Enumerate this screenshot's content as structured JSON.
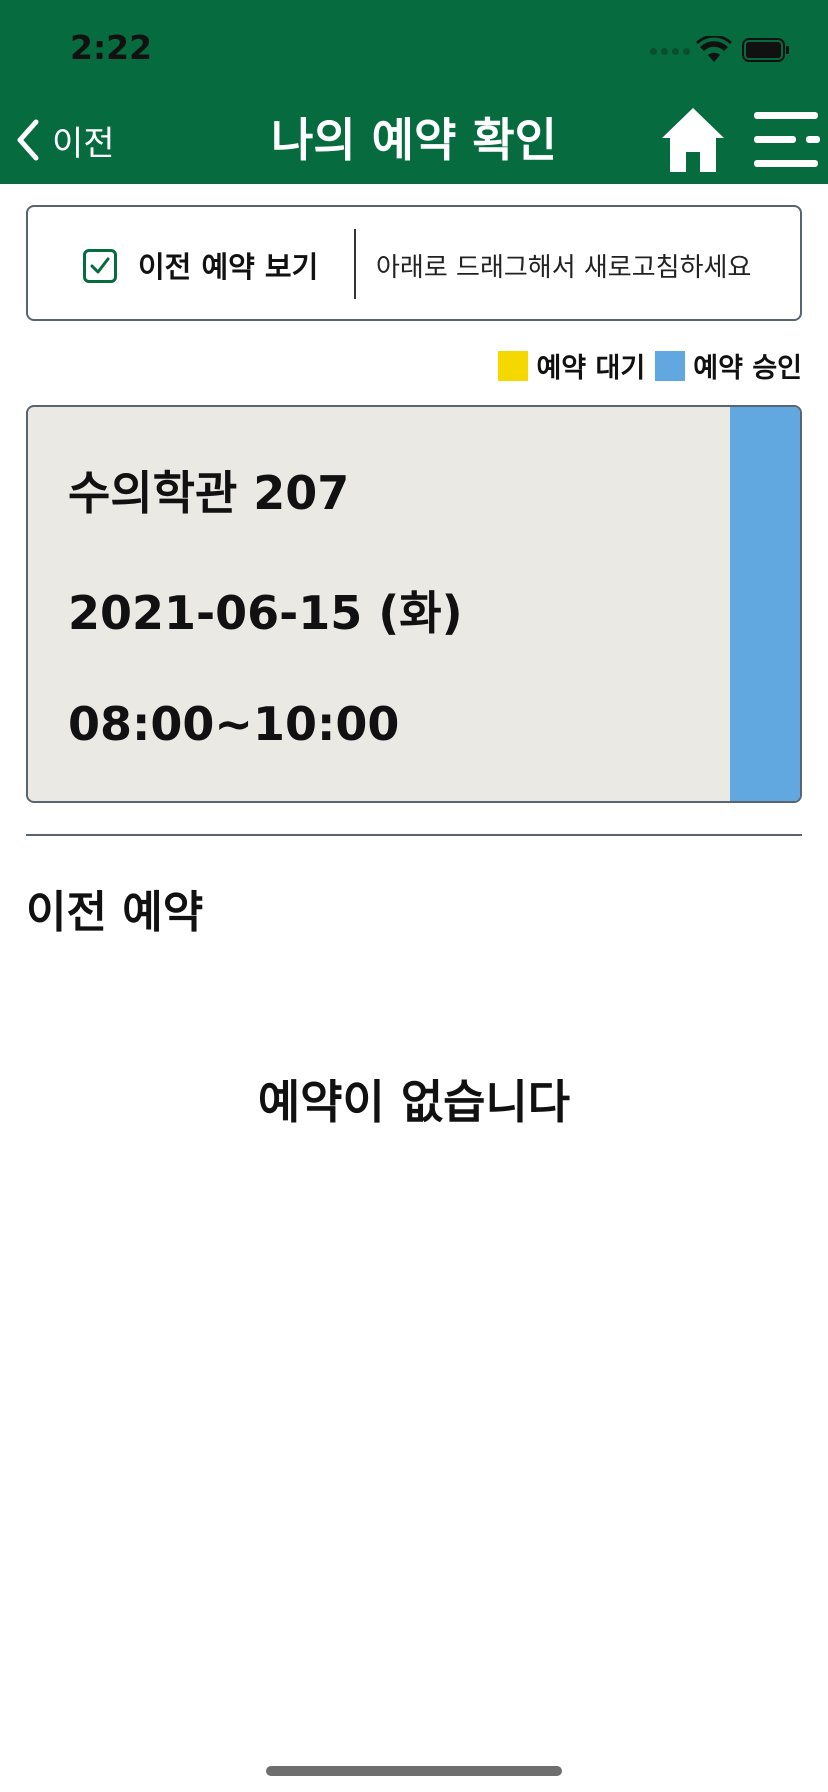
{
  "status_bar": {
    "time": "2:22"
  },
  "header": {
    "back_label": "이전",
    "title": "나의 예약 확인",
    "home_icon": "home-icon",
    "menu_icon": "hamburger-menu-icon",
    "background_color": "#066b3e"
  },
  "controls": {
    "checkbox_label": "이전 예약 보기",
    "checkbox_checked": true,
    "refresh_hint": "아래로 드래그해서 새로고침하세요"
  },
  "legend": {
    "items": [
      {
        "label": "예약 대기",
        "color": "#f5d800"
      },
      {
        "label": "예약 승인",
        "color": "#62a8e0"
      }
    ]
  },
  "reservation": {
    "location": "수의학관 207",
    "date": "2021-06-15 (화)",
    "time": "08:00~10:00",
    "status": "예약 승인",
    "status_color": "#62a8e0"
  },
  "past_section": {
    "title": "이전 예약",
    "empty_message": "예약이 없습니다"
  }
}
